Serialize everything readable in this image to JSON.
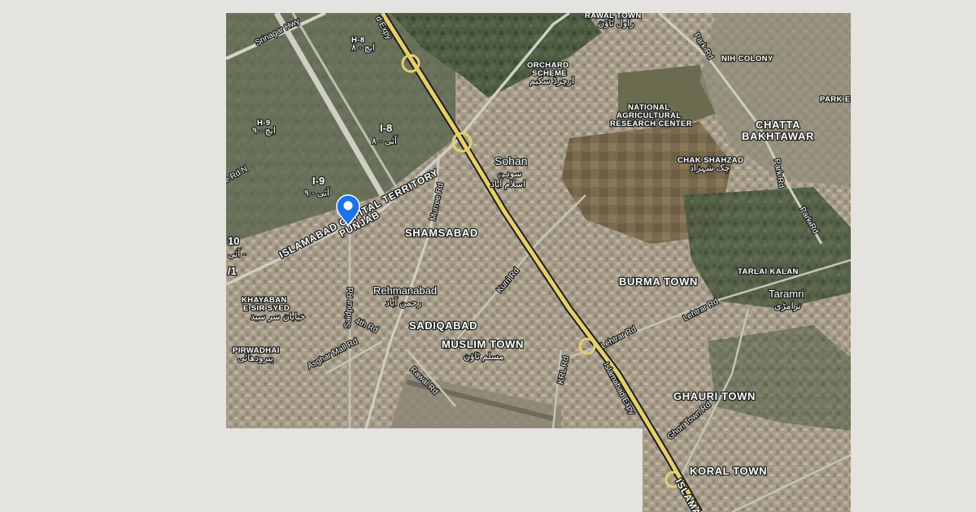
{
  "map": {
    "view": "satellite",
    "marker": {
      "type": "location-pin",
      "color": "#1a73e8"
    },
    "colors": {
      "background": "#e5e3df",
      "urban": "#a99f8e",
      "vegetation": "#4a5a40",
      "highway": "#e6cf6e",
      "road": "#cfcfc4"
    },
    "places": {
      "rawal_town": "RAWAL TOWN",
      "rawal_town_ur": "راول ٹاؤن",
      "nih_colony": "NIH COLONY",
      "park_e": "PARK E",
      "orchard_1": "ORCHARD",
      "orchard_2": "SCHEME",
      "orchard_ur": "ارچرڈ سکیم",
      "narc_1": "NATIONAL",
      "narc_2": "AGRICULTURAL",
      "narc_3": "RESEARCH CENTER",
      "chatta_1": "CHATTA",
      "chatta_2": "BAKHTAWAR",
      "chak_shahzad": "CHAK SHAHZAD",
      "chak_shahzad_ur": "چک شہزاد",
      "sohan": "Sohan",
      "sohan_ur": "سوہن",
      "islamabad_ur": "اسلام آباد",
      "h8": "H-8",
      "h8_ur": "ایچ - ۸",
      "h9": "H-9",
      "h9_ur": "ایچ - ۹",
      "i8": "I-8",
      "i8_ur": "آئی - ۸",
      "i9": "I-9",
      "i9_ur": "آئی - ۹",
      "i10": "10",
      "i10_ur": "آئی -",
      "i11": "/1",
      "territory": "ISLAMABAD CAPITAL TERRITORY",
      "punjab": "PUNJAB",
      "shamsabad": "SHAMSABAD",
      "rehmanabad": "Rehmanabad",
      "rehmanabad_ur": "رحمن آباد",
      "khayaban_1": "KHAYABAN",
      "khayaban_2": "E SIR SYED",
      "khayaban_ur": "خیابان سر سید",
      "pirwadhai": "PIRWADHAI",
      "pirwadhai_ur": "پیرودھائی",
      "sadiqabad": "SADIQABAD",
      "muslim_town": "MUSLIM TOWN",
      "muslim_town_ur": "مسلم ٹاؤن",
      "burma_town": "BURMA TOWN",
      "tarlai_kalan": "TARLAI KALAN",
      "taramri": "Taramri",
      "taramri_ur": "ترامڑی",
      "ghauri_town": "GHAURI TOWN",
      "koral_town": "KORAL TOWN",
      "islamabad_route": "ISLAMA"
    },
    "roads": {
      "srinagar": "Srinagar Hwy",
      "expy_top": "d Expy",
      "park_rd_1": "Park Rd",
      "park_rd_2": "Park Rd",
      "park_rd_3": "Park Rd",
      "murree_rd": "Murree Rd",
      "kurri_rd": "Kurri Rd",
      "saidpur_rd": "Saidpur Rd",
      "fourth_rd": "4th Rd",
      "asghar_mall": "Asghar Mall Rd",
      "rawal_rd": "Rawal Rd",
      "khr_rd": "KRL Rd",
      "lehtrar_1": "Lehtrar Rd",
      "lehtrar_2": "Lehtrar Rd",
      "islamabad_expy": "Islamabad Expy",
      "ghori_town_rd": "Ghori Town Rd",
      "left_rd": "e Rd N"
    }
  }
}
